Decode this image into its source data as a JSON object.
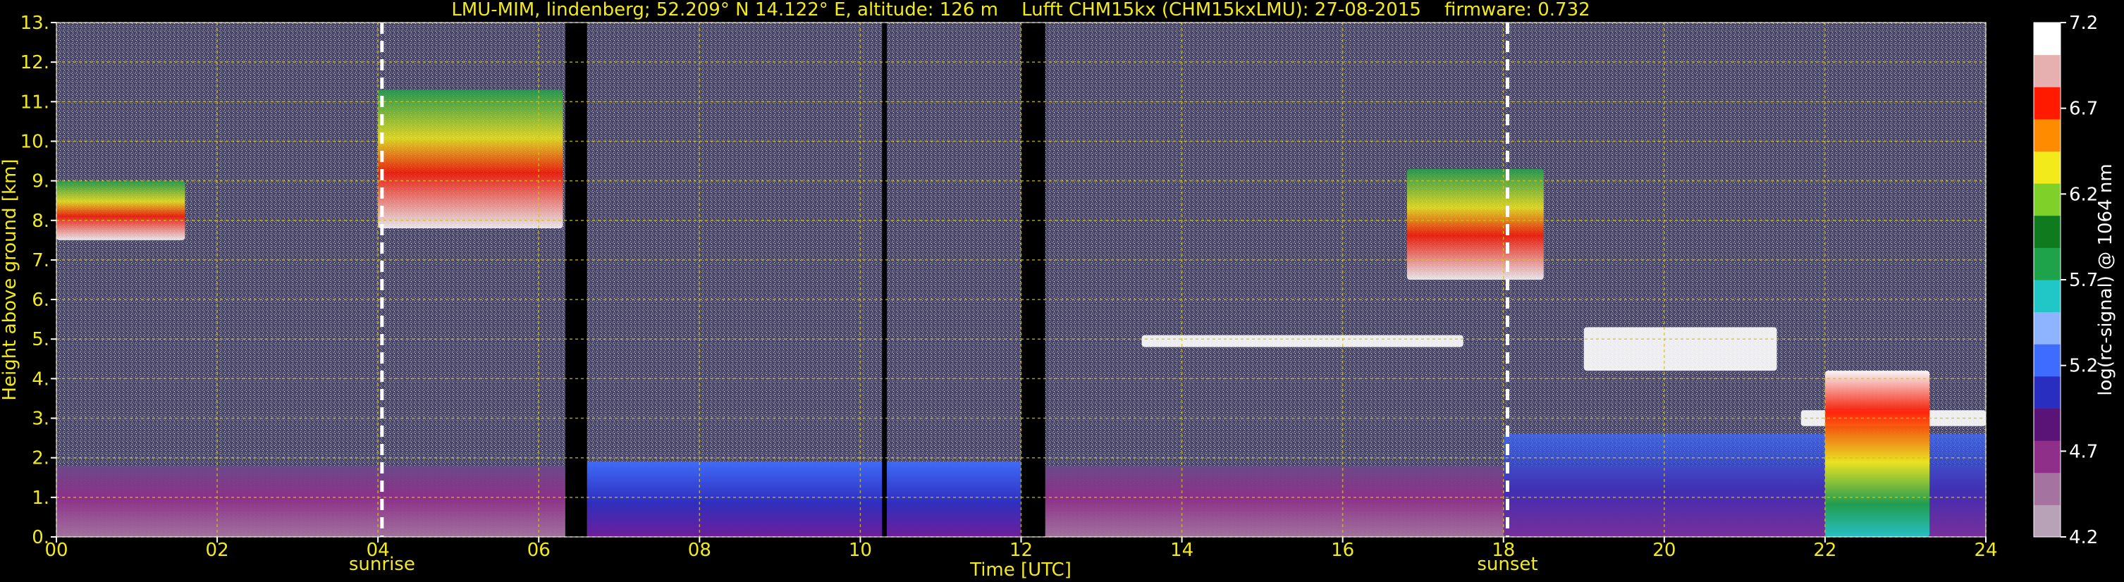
{
  "chart_data": {
    "type": "heatmap",
    "title": "LMU-MIM, lindenberg; 52.209° N 14.122° E, altitude: 126 m    Lufft CHM15kx (CHM15kxLMU): 27-08-2015    firmware: 0.732",
    "xlabel": "Time [UTC]",
    "ylabel": "Height above ground [km]",
    "colorbar_label": "log(rc-signal) @ 1064 nm",
    "xlim": [
      0,
      24
    ],
    "ylim": [
      0,
      13
    ],
    "x_ticks": [
      "00",
      "02",
      "04",
      "06",
      "08",
      "10",
      "12",
      "14",
      "16",
      "18",
      "20",
      "22",
      "24"
    ],
    "x_tick_values": [
      0,
      2,
      4,
      6,
      8,
      10,
      12,
      14,
      16,
      18,
      20,
      22,
      24
    ],
    "y_ticks": [
      "0.",
      "1.",
      "2.",
      "3.",
      "4.",
      "5.",
      "6.",
      "7.",
      "8.",
      "9.",
      "10.",
      "11.",
      "12.",
      "13."
    ],
    "y_tick_values": [
      0,
      1,
      2,
      3,
      4,
      5,
      6,
      7,
      8,
      9,
      10,
      11,
      12,
      13
    ],
    "colorbar_ticks": [
      "4.2",
      "4.7",
      "5.2",
      "5.7",
      "6.2",
      "6.7",
      "7.2"
    ],
    "colorbar_tick_values": [
      4.2,
      4.7,
      5.2,
      5.7,
      6.2,
      6.7,
      7.2
    ],
    "colorbar_range": [
      4.2,
      7.2
    ],
    "colorbar_colors": [
      "#b8a2b8",
      "#a5739f",
      "#8f2f8a",
      "#5a1478",
      "#2a2ec0",
      "#3d6cff",
      "#8fb4ff",
      "#21c6c6",
      "#1fa34a",
      "#0f7a1e",
      "#7fd12a",
      "#f2ea1a",
      "#ff8c00",
      "#ff1a00",
      "#e6b0b0",
      "#ffffff"
    ],
    "markers": [
      {
        "label": "sunrise",
        "time": 4.05
      },
      {
        "label": "sunset",
        "time": 18.05
      }
    ],
    "data_gaps": [
      [
        6.33,
        6.6
      ],
      [
        10.27,
        10.33
      ],
      [
        12.0,
        12.3
      ]
    ],
    "features": [
      {
        "kind": "boundary layer",
        "t_start": 0,
        "t_end": 24,
        "top_km": 1.8
      },
      {
        "kind": "cirrus",
        "t_start": 0,
        "t_end": 1.6,
        "base_km": 7.5,
        "top_km": 9.0
      },
      {
        "kind": "cirrus",
        "t_start": 4.0,
        "t_end": 6.3,
        "base_km": 7.8,
        "top_km": 11.3
      },
      {
        "kind": "cirrus",
        "t_start": 16.8,
        "t_end": 18.5,
        "base_km": 6.5,
        "top_km": 9.3
      },
      {
        "kind": "mid-level cloud",
        "t_start": 13.5,
        "t_end": 17.5,
        "base_km": 4.8,
        "top_km": 5.1
      },
      {
        "kind": "mid-level cloud",
        "t_start": 19.0,
        "t_end": 21.4,
        "base_km": 4.2,
        "top_km": 5.3
      },
      {
        "kind": "low cloud",
        "t_start": 21.7,
        "t_end": 24,
        "base_km": 2.8,
        "top_km": 3.2
      },
      {
        "kind": "precipitation",
        "t_start": 22.0,
        "t_end": 23.3,
        "base_km": 0.0,
        "top_km": 4.2
      }
    ],
    "grid": true,
    "legend": "colorbar right"
  }
}
